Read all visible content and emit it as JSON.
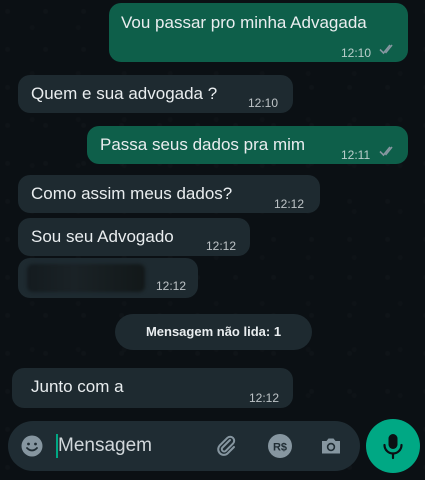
{
  "messages": [
    {
      "direction": "outgoing",
      "text": "Vou passar pro minha Advagada",
      "time": "12:10",
      "status": "read"
    },
    {
      "direction": "incoming",
      "text": "Quem e sua advogada ?",
      "time": "12:10"
    },
    {
      "direction": "outgoing",
      "text": "Passa seus dados pra mim",
      "time": "12:11",
      "status": "read"
    },
    {
      "direction": "incoming",
      "text": "Como assim meus dados?",
      "time": "12:12"
    },
    {
      "direction": "incoming",
      "text": "Sou seu Advogado",
      "time": "12:12"
    },
    {
      "direction": "incoming",
      "text": "",
      "time": "12:12",
      "redacted": true
    },
    {
      "direction": "incoming",
      "text": "Junto com a",
      "time": "12:12"
    }
  ],
  "unread_divider": "Mensagem não lida: 1",
  "composer": {
    "placeholder": "Mensagem",
    "icons": [
      "emoji-icon",
      "attach-icon",
      "payment-icon",
      "camera-icon"
    ],
    "send_icon": "mic-icon"
  },
  "colors": {
    "outgoing_bubble": "#0e5f4a",
    "incoming_bubble": "#1e2a30",
    "accent": "#00a884",
    "background": "#0b1014"
  }
}
